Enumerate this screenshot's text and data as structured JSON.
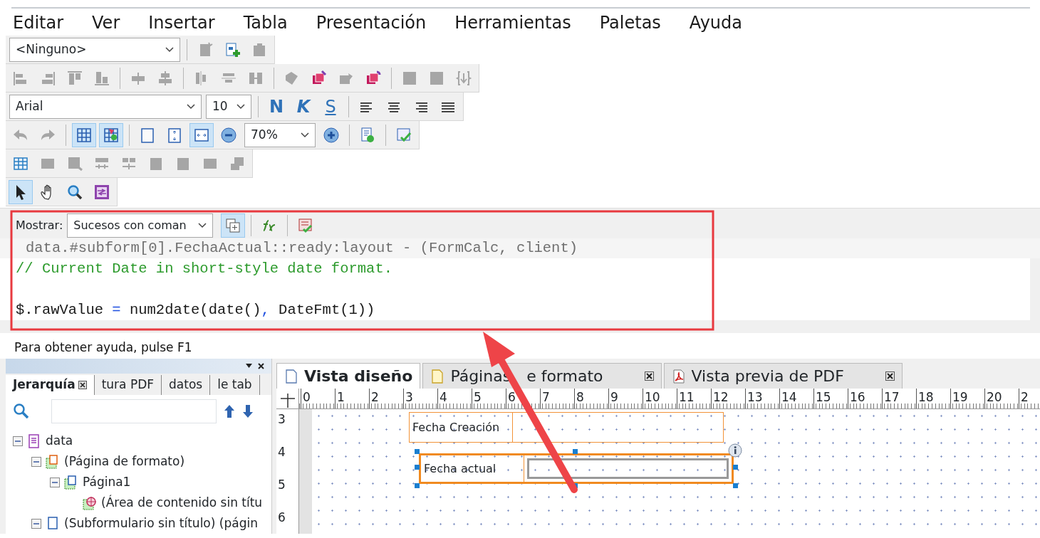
{
  "menu": [
    {
      "label": "Editar"
    },
    {
      "label": "Ver"
    },
    {
      "label": "Insertar"
    },
    {
      "label": "Tabla"
    },
    {
      "label": "Presentación"
    },
    {
      "label": "Herramientas"
    },
    {
      "label": "Paletas"
    },
    {
      "label": "Ayuda"
    }
  ],
  "toolbars": [
    [
      {
        "kind": "combo",
        "value": "<Ninguno>"
      },
      {
        "kind": "sep"
      },
      {
        "kind": "button",
        "pressed": false,
        "disabled": true
      },
      {
        "kind": "button",
        "pressed": false,
        "disabled": false
      },
      {
        "kind": "button",
        "pressed": false,
        "disabled": true
      }
    ],
    [
      {
        "kind": "button",
        "pressed": false,
        "disabled": true
      },
      {
        "kind": "button",
        "pressed": false,
        "disabled": true
      },
      {
        "kind": "button",
        "pressed": false,
        "disabled": true
      },
      {
        "kind": "button",
        "pressed": false,
        "disabled": true
      },
      {
        "kind": "sep"
      },
      {
        "kind": "button",
        "pressed": false,
        "disabled": true
      },
      {
        "kind": "button",
        "pressed": false,
        "disabled": true
      },
      {
        "kind": "sep"
      },
      {
        "kind": "button",
        "pressed": false,
        "disabled": true
      },
      {
        "kind": "button",
        "pressed": false,
        "disabled": true
      },
      {
        "kind": "button",
        "pressed": false,
        "disabled": true
      },
      {
        "kind": "sep"
      },
      {
        "kind": "button",
        "pressed": false,
        "disabled": true
      },
      {
        "kind": "button",
        "pressed": false,
        "disabled": false
      },
      {
        "kind": "button",
        "pressed": false,
        "disabled": true
      },
      {
        "kind": "button",
        "pressed": false,
        "disabled": false
      },
      {
        "kind": "sep"
      },
      {
        "kind": "button",
        "pressed": false,
        "disabled": true
      },
      {
        "kind": "button",
        "pressed": false,
        "disabled": true
      },
      {
        "kind": "button",
        "pressed": false,
        "disabled": true
      }
    ],
    [
      {
        "kind": "combo",
        "value": "Arial"
      },
      {
        "kind": "combo",
        "value": "10"
      },
      {
        "kind": "sep"
      },
      {
        "kind": "text",
        "label": "N",
        "pressed": false
      },
      {
        "kind": "text",
        "label": "K",
        "pressed": false
      },
      {
        "kind": "text",
        "label": "S",
        "pressed": false
      },
      {
        "kind": "sep"
      },
      {
        "kind": "button",
        "pressed": false,
        "disabled": false
      },
      {
        "kind": "button",
        "pressed": false,
        "disabled": false
      },
      {
        "kind": "button",
        "pressed": false,
        "disabled": false
      },
      {
        "kind": "button",
        "pressed": false,
        "disabled": false
      }
    ],
    [
      {
        "kind": "button",
        "pressed": false,
        "disabled": true
      },
      {
        "kind": "button",
        "pressed": false,
        "disabled": true
      },
      {
        "kind": "sep"
      },
      {
        "kind": "button",
        "pressed": true,
        "disabled": false
      },
      {
        "kind": "button",
        "pressed": true,
        "disabled": false
      },
      {
        "kind": "sep"
      },
      {
        "kind": "button",
        "pressed": false,
        "disabled": false
      },
      {
        "kind": "button",
        "pressed": false,
        "disabled": false
      },
      {
        "kind": "button",
        "pressed": true,
        "disabled": false
      },
      {
        "kind": "button",
        "pressed": false,
        "disabled": false
      },
      {
        "kind": "combo",
        "value": "70%"
      },
      {
        "kind": "button",
        "pressed": false,
        "disabled": false
      },
      {
        "kind": "sep"
      },
      {
        "kind": "button",
        "pressed": false,
        "disabled": false
      },
      {
        "kind": "sep"
      },
      {
        "kind": "button",
        "pressed": false,
        "disabled": false
      }
    ],
    [
      {
        "kind": "button",
        "pressed": false,
        "disabled": false
      },
      {
        "kind": "button",
        "pressed": false,
        "disabled": true
      },
      {
        "kind": "button",
        "pressed": false,
        "disabled": true
      },
      {
        "kind": "button",
        "pressed": false,
        "disabled": true
      },
      {
        "kind": "button",
        "pressed": false,
        "disabled": true
      },
      {
        "kind": "button",
        "pressed": false,
        "disabled": true
      },
      {
        "kind": "button",
        "pressed": false,
        "disabled": true
      },
      {
        "kind": "button",
        "pressed": false,
        "disabled": true
      },
      {
        "kind": "button",
        "pressed": false,
        "disabled": true
      }
    ],
    [
      {
        "kind": "button",
        "pressed": true,
        "disabled": false
      },
      {
        "kind": "button",
        "pressed": false,
        "disabled": false
      },
      {
        "kind": "button",
        "pressed": false,
        "disabled": false
      },
      {
        "kind": "button",
        "pressed": false,
        "disabled": false
      }
    ]
  ],
  "script_editor": {
    "show_label": "Mostrar:",
    "show_value": "Sucesos con coman",
    "tools": [
      {
        "pressed": true
      },
      {
        "pressed": false
      },
      {
        "pressed": false
      }
    ],
    "header": "data.#subform[0].FechaActual::ready:layout - (FormCalc, client)",
    "lines": [
      {
        "kind": "comment",
        "tokens": [
          {
            "kind": "comment",
            "text": "// Current Date in short-style date format."
          }
        ]
      },
      {
        "kind": "blank"
      },
      {
        "kind": "code",
        "tokens": [
          {
            "kind": "plain",
            "text": "$.rawValue "
          },
          {
            "kind": "operator",
            "text": "="
          },
          {
            "kind": "plain",
            "text": " num2date(date()"
          },
          {
            "kind": "operator",
            "text": ","
          },
          {
            "kind": "plain",
            "text": " DateFmt(1))"
          }
        ]
      }
    ]
  },
  "status_bar": "Para obtener ayuda, pulse F1",
  "hierarchy": {
    "tabs": [
      {
        "label": "Jerarquía",
        "selected": true
      },
      {
        "label": "tura PDF",
        "selected": false
      },
      {
        "label": "datos",
        "selected": false
      },
      {
        "label": "le tab",
        "selected": false
      }
    ],
    "tree": [
      {
        "label": "data",
        "kind": "root",
        "expanded": true,
        "children": [
          {
            "label": "(Página de formato)",
            "kind": "master",
            "expanded": true,
            "children": [
              {
                "label": "Página1",
                "kind": "page",
                "expanded": true,
                "children": [
                  {
                    "label": "(Área de contenido sin títu",
                    "kind": "content-area"
                  }
                ]
              }
            ]
          },
          {
            "label": "(Subformulario sin título) (págin",
            "kind": "subform",
            "expanded": true
          }
        ]
      }
    ]
  },
  "design": {
    "tabs": [
      {
        "label": "Vista diseño",
        "selected": true,
        "closable": false,
        "kind": "page"
      },
      {
        "label": "Páginas",
        "label_rest": "e formato",
        "selected": false,
        "closable": true,
        "kind": "master"
      },
      {
        "label": "Vista previa de PDF",
        "selected": false,
        "closable": true,
        "kind": "pdf"
      }
    ],
    "ruler": [
      "0",
      "1",
      "2",
      "3",
      "4",
      "5",
      "6",
      "7",
      "8",
      "9",
      "10",
      "11",
      "12",
      "13",
      "14",
      "15",
      "16",
      "17",
      "18",
      "19",
      "20",
      "2"
    ],
    "vruler": [
      "3",
      "4",
      "5",
      "6"
    ],
    "fields": [
      {
        "caption": "Fecha Creación",
        "selected": false
      },
      {
        "caption": "Fecha actual",
        "selected": true
      }
    ]
  }
}
